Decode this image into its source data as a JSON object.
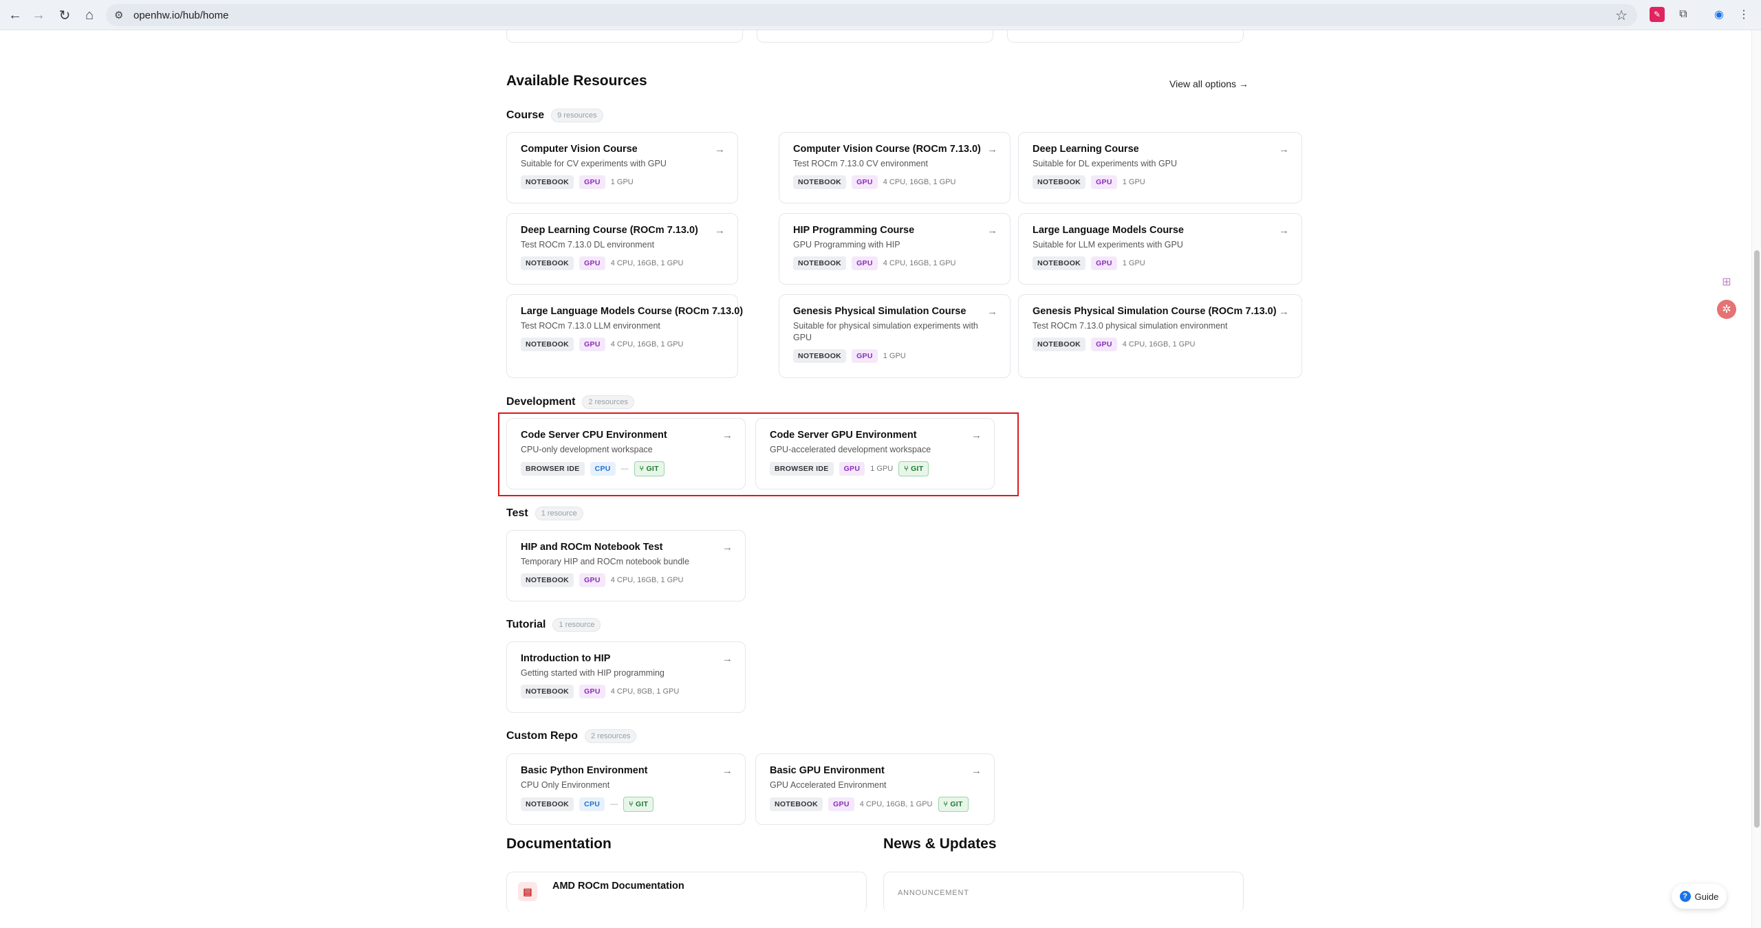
{
  "browser": {
    "url": "openhw.io/hub/home",
    "back_icon": "arrow-left",
    "forward_icon": "arrow-right",
    "reload_icon": "reload",
    "home_icon": "home"
  },
  "resources": {
    "heading": "Available Resources",
    "view_all": "View all options →",
    "groups": [
      {
        "name": "Course",
        "count": "9 resources",
        "cards": [
          {
            "title": "Computer Vision Course",
            "desc": "Suitable for CV experiments with GPU",
            "type": "NOTEBOOK",
            "accel": "GPU",
            "spec": "1 GPU"
          },
          {
            "title": "Computer Vision Course (ROCm 7.13.0)",
            "desc": "Test ROCm 7.13.0 CV environment",
            "type": "NOTEBOOK",
            "accel": "GPU",
            "spec": "4 CPU, 16GB, 1 GPU"
          },
          {
            "title": "Deep Learning Course",
            "desc": "Suitable for DL experiments with GPU",
            "type": "NOTEBOOK",
            "accel": "GPU",
            "spec": "1 GPU"
          },
          {
            "title": "Deep Learning Course (ROCm 7.13.0)",
            "desc": "Test ROCm 7.13.0 DL environment",
            "type": "NOTEBOOK",
            "accel": "GPU",
            "spec": "4 CPU, 16GB, 1 GPU"
          },
          {
            "title": "HIP Programming Course",
            "desc": "GPU Programming with HIP",
            "type": "NOTEBOOK",
            "accel": "GPU",
            "spec": "4 CPU, 16GB, 1 GPU"
          },
          {
            "title": "Large Language Models Course",
            "desc": "Suitable for LLM experiments with GPU",
            "type": "NOTEBOOK",
            "accel": "GPU",
            "spec": "1 GPU"
          },
          {
            "title": "Large Language Models Course (ROCm 7.13.0)",
            "desc": "Test ROCm 7.13.0 LLM environment",
            "type": "NOTEBOOK",
            "accel": "GPU",
            "spec": "4 CPU, 16GB, 1 GPU"
          },
          {
            "title": "Genesis Physical Simulation Course",
            "desc": "Suitable for physical simulation experiments with GPU",
            "type": "NOTEBOOK",
            "accel": "GPU",
            "spec": "1 GPU"
          },
          {
            "title": "Genesis Physical Simulation Course (ROCm 7.13.0)",
            "desc": "Test ROCm 7.13.0 physical simulation environment",
            "type": "NOTEBOOK",
            "accel": "GPU",
            "spec": "4 CPU, 16GB, 1 GPU"
          }
        ]
      },
      {
        "name": "Development",
        "count": "2 resources",
        "cards": [
          {
            "title": "Code Server CPU Environment",
            "desc": "CPU-only development workspace",
            "type": "BROWSER IDE",
            "accel": "CPU",
            "spec": "—",
            "git": "GIT"
          },
          {
            "title": "Code Server GPU Environment",
            "desc": "GPU-accelerated development workspace",
            "type": "BROWSER IDE",
            "accel": "GPU",
            "spec": "1 GPU",
            "git": "GIT"
          }
        ]
      },
      {
        "name": "Test",
        "count": "1 resource",
        "cards": [
          {
            "title": "HIP and ROCm Notebook Test",
            "desc": "Temporary HIP and ROCm notebook bundle",
            "type": "NOTEBOOK",
            "accel": "GPU",
            "spec": "4 CPU, 16GB, 1 GPU"
          }
        ]
      },
      {
        "name": "Tutorial",
        "count": "1 resource",
        "cards": [
          {
            "title": "Introduction to HIP",
            "desc": "Getting started with HIP programming",
            "type": "NOTEBOOK",
            "accel": "GPU",
            "spec": "4 CPU, 8GB, 1 GPU"
          }
        ]
      },
      {
        "name": "Custom Repo",
        "count": "2 resources",
        "cards": [
          {
            "title": "Basic Python Environment",
            "desc": "CPU Only Environment",
            "type": "NOTEBOOK",
            "accel": "CPU",
            "spec": "—",
            "git": "GIT"
          },
          {
            "title": "Basic GPU Environment",
            "desc": "GPU Accelerated Environment",
            "type": "NOTEBOOK",
            "accel": "GPU",
            "spec": "4 CPU, 16GB, 1 GPU",
            "git": "GIT"
          }
        ]
      }
    ]
  },
  "documentation": {
    "heading": "Documentation",
    "first_item": "AMD ROCm Documentation"
  },
  "news": {
    "heading": "News & Updates",
    "first_label": "ANNOUNCEMENT"
  },
  "guide_button": {
    "label": "Guide",
    "icon": "?"
  },
  "colors": {
    "highlight": "#d81b1b",
    "gpu": "#8a2db5",
    "cpu": "#1f6fc9",
    "git": "#1d7a2d"
  }
}
